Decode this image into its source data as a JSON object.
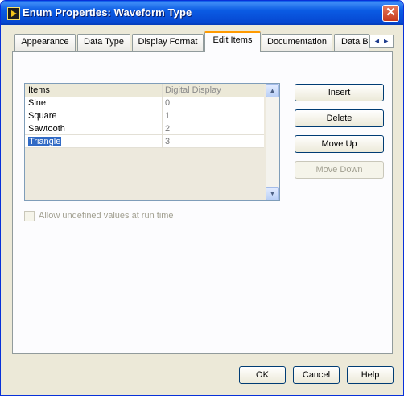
{
  "window": {
    "title": "Enum Properties: Waveform Type"
  },
  "tabs": [
    {
      "label": "Appearance"
    },
    {
      "label": "Data Type"
    },
    {
      "label": "Display Format"
    },
    {
      "label": "Edit Items",
      "active": true
    },
    {
      "label": "Documentation"
    },
    {
      "label": "Data Bi"
    }
  ],
  "tab_scroll": {
    "left": "◄",
    "right": "►"
  },
  "table": {
    "headers": [
      "Items",
      "Digital Display"
    ],
    "rows": [
      {
        "item": "Sine",
        "value": "0"
      },
      {
        "item": "Square",
        "value": "1"
      },
      {
        "item": "Sawtooth",
        "value": "2"
      },
      {
        "item": "Triangle",
        "value": "3",
        "selected": true
      }
    ]
  },
  "scroll": {
    "up": "▲",
    "down": "▼"
  },
  "side_buttons": {
    "insert": "Insert",
    "delete": "Delete",
    "move_up": "Move Up",
    "move_down": "Move Down"
  },
  "allow_undefined": {
    "label": "Allow undefined values at run time",
    "checked": false,
    "enabled": false
  },
  "footer_buttons": {
    "ok": "OK",
    "cancel": "Cancel",
    "help": "Help"
  },
  "close_glyph": "✕",
  "colors": {
    "title_bar": "#0b5ce4",
    "selection": "#316ac5",
    "active_tab_accent": "#ff9a00"
  }
}
